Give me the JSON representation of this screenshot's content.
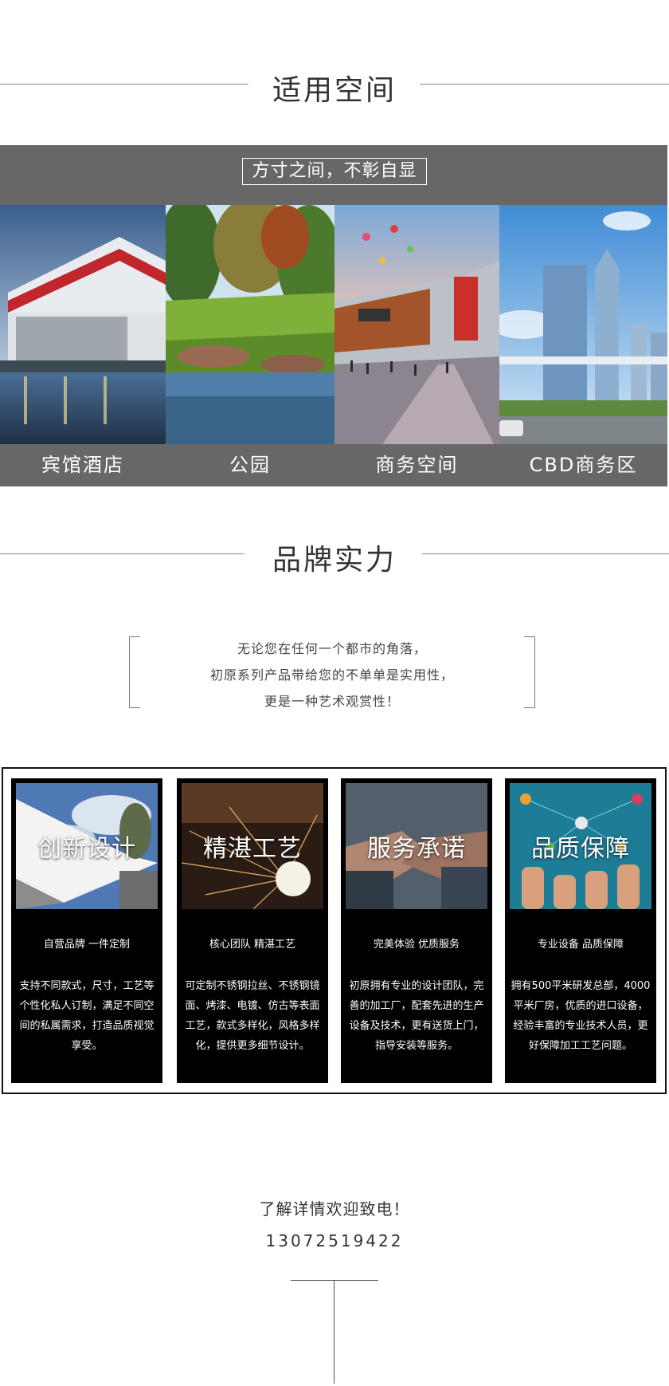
{
  "section1": {
    "title": "适用空间"
  },
  "spaces": {
    "slogan": "方寸之间，不彰自显",
    "items": [
      {
        "caption": "宾馆酒店",
        "image": "hotel-building-photo"
      },
      {
        "caption": "公园",
        "image": "park-lake-photo"
      },
      {
        "caption": "商务空间",
        "image": "commercial-street-photo"
      },
      {
        "caption": "CBD商务区",
        "image": "cbd-towers-photo"
      }
    ]
  },
  "section2": {
    "title": "品牌实力"
  },
  "quote": {
    "lines": [
      "无论您在任何一个都市的角落，",
      "初原系列产品带给您的不单单是实用性，",
      "更是一种艺术观赏性！"
    ]
  },
  "features": [
    {
      "title": "创新设计",
      "subtitle": "自营品牌 一件定制",
      "desc": [
        "支持不同款式，尺寸，工艺等",
        "个性化私人订制，满足不同空",
        "间的私属需求，打造品质视觉",
        "享受。"
      ]
    },
    {
      "title": "精湛工艺",
      "subtitle": "核心团队 精湛工艺",
      "desc": [
        "可定制不锈钢拉丝、不锈钢镜",
        "面、烤漆、电镀、仿古等表面",
        "工艺，款式多样化，风格多样",
        "化，提供更多细节设计。"
      ]
    },
    {
      "title": "服务承诺",
      "subtitle": "完美体验 优质服务",
      "desc": [
        "初原拥有专业的设计团队，完",
        "善的加工厂，配套先进的生产",
        "设备及技术，更有送货上门，",
        "指导安装等服务。"
      ]
    },
    {
      "title": "品质保障",
      "subtitle": "专业设备 品质保障",
      "desc": [
        "拥有500平米研发总部，4000",
        "平米厂房，优质的进口设备，",
        "经验丰富的专业技术人员，更",
        "好保障加工工艺问题。"
      ]
    }
  ],
  "contact": {
    "text": "了解详情欢迎致电！",
    "phone": "13072519422"
  }
}
